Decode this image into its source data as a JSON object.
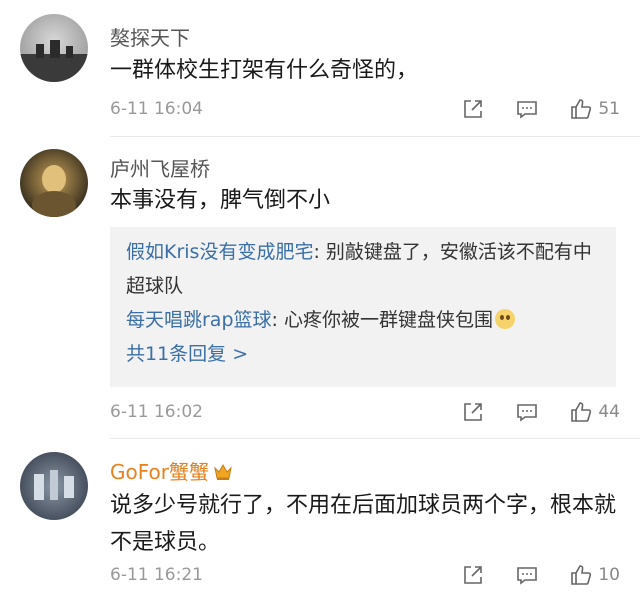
{
  "comments": [
    {
      "username": "獒探天下",
      "text": "一群体校生打架有什么奇怪的，",
      "time": "6-11 16:04",
      "likes": "51"
    },
    {
      "username": "庐州飞屋桥",
      "text": "本事没有，脾气倒不小",
      "replies": [
        {
          "user": "假如Kris没有变成肥宅",
          "text": ": 别敲键盘了，安徽活该不配有中超球队"
        },
        {
          "user": "每天唱跳rap篮球",
          "text": ": 心疼你被一群键盘侠包围"
        }
      ],
      "more_replies": "共11条回复 >",
      "time": "6-11 16:02",
      "likes": "44"
    },
    {
      "username": "GoFor蟹蟹",
      "text": "说多少号就行了，不用在后面加球员两个字，根本就不是球员。",
      "time": "6-11 16:21",
      "likes": "10"
    }
  ],
  "icons": {
    "share": "share-icon",
    "reply": "comment-icon",
    "like": "thumbs-up-icon",
    "emoji": "wronged-face-emoji",
    "badge": "crown-badge-icon"
  },
  "colors": {
    "link": "#3a6fa8",
    "vip_name": "#e6811f",
    "meta": "#999999",
    "reply_bg": "#f2f2f2"
  }
}
